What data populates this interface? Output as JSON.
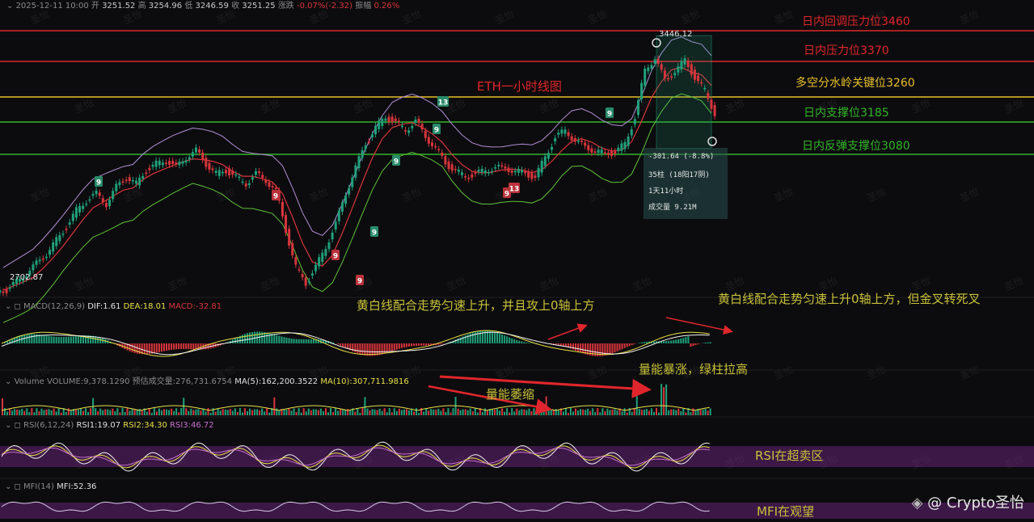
{
  "header": {
    "date": "2025-12-11 10:00",
    "open_label": "开",
    "open": "3251.52",
    "high_label": "高",
    "high": "3254.96",
    "low_label": "低",
    "low": "3246.59",
    "close_label": "收",
    "close": "3251.25",
    "change_label": "涨跌",
    "change": "-0.07%(-2.32)",
    "amplitude_label": "振幅",
    "amplitude": "0.26%"
  },
  "chart_title": "ETH一小时线图",
  "price_labels": {
    "max": "3446.12",
    "min": "2702.87"
  },
  "levels": [
    {
      "label": "日内回调压力位3460",
      "price": 3460,
      "color": "#e0262c"
    },
    {
      "label": "日内压力位3370",
      "price": 3370,
      "color": "#e0262c"
    },
    {
      "label": "多空分水岭关键位3260",
      "price": 3260,
      "color": "#e9c02a"
    },
    {
      "label": "日内支撑位3185",
      "price": 3185,
      "color": "#33b52a"
    },
    {
      "label": "日内反弹支撑位3080",
      "price": 3080,
      "color": "#33b52a"
    }
  ],
  "measure_box": {
    "change": "-301.64 (-8.8%)",
    "bars": "35柱 (18阳17阴)",
    "duration": "1天11小时",
    "volume": "成交量 9.21M"
  },
  "td_markers": [
    "9",
    "9",
    "9",
    "9",
    "9",
    "9",
    "13",
    "9",
    "9",
    "13",
    "9"
  ],
  "macd": {
    "name": "MACD(12,26,9)",
    "dif_label": "DIF:",
    "dif": "1.61",
    "dea_label": "DEA:",
    "dea": "18.01",
    "macd_label": "MACD:",
    "macd": "-32.81"
  },
  "volume": {
    "name": "Volume",
    "vol": "VOLUME:9,378.1290",
    "est": "预估成交量:276,731.6754",
    "ma5": "MA(5):162,200.3522",
    "ma10": "MA(10):307,711.9816"
  },
  "rsi": {
    "name": "RSI(6,12,24)",
    "rsi1": "RSI1:19.07",
    "rsi2": "RSI2:34.30",
    "rsi3": "RSI3:46.72"
  },
  "mfi": {
    "name": "MFI(14)",
    "mfi": "MFI:52.36"
  },
  "annotations": {
    "macd1": "黄白线配合走势匀速上升，并且攻上0轴上方",
    "macd2": "黄白线配合走势匀速上升0轴上方，但金叉转死叉",
    "vol_up": "量能暴涨，绿柱拉高",
    "vol_down": "量能萎缩",
    "rsi": "RSI在超卖区",
    "mfi": "MFI在观望"
  },
  "brand": "@ Crypto圣怡",
  "watermark": "圣怡",
  "colors": {
    "up": "#1fa07a",
    "down": "#d8353c",
    "boll_upper": "#b38fd6",
    "boll_mid": "#d8353c",
    "boll_lower": "#5fc23a",
    "dif": "#e9e04a",
    "dea": "#f2f2f2"
  },
  "chart_data": {
    "type": "candlestick",
    "title": "ETH一小时线图",
    "x": [
      "t0",
      "t1",
      "t2",
      "t3",
      "t4",
      "t5",
      "t6",
      "t7",
      "t8",
      "t9",
      "t10",
      "t11",
      "t12",
      "t13",
      "t14",
      "t15",
      "t16",
      "t17",
      "t18",
      "t19",
      "t20",
      "t21",
      "t22",
      "t23",
      "t24",
      "t25",
      "t26",
      "t27",
      "t28",
      "t29",
      "t30",
      "t31",
      "t32",
      "t33",
      "t34",
      "t35",
      "t36",
      "t37",
      "t38",
      "t39",
      "t40",
      "t41",
      "t42",
      "t43",
      "t44",
      "t45",
      "t46",
      "t47",
      "t48",
      "t49",
      "t50",
      "t51",
      "t52",
      "t53",
      "t54",
      "t55",
      "t56",
      "t57",
      "t58",
      "t59",
      "t60",
      "t61",
      "t62",
      "t63",
      "t64",
      "t65",
      "t66",
      "t67",
      "t68",
      "t69",
      "t70",
      "t71"
    ],
    "close": [
      2720,
      2745,
      2770,
      2800,
      2830,
      2870,
      2910,
      2960,
      2990,
      3010,
      2980,
      3030,
      3060,
      3040,
      3080,
      3100,
      3110,
      3090,
      3120,
      3140,
      3100,
      3070,
      3080,
      3060,
      3040,
      3070,
      3050,
      3020,
      2900,
      2790,
      2740,
      2790,
      2850,
      2920,
      3010,
      3090,
      3160,
      3210,
      3240,
      3225,
      3200,
      3230,
      3180,
      3150,
      3100,
      3080,
      3060,
      3070,
      3080,
      3090,
      3085,
      3080,
      3070,
      3060,
      3120,
      3180,
      3200,
      3170,
      3150,
      3140,
      3130,
      3135,
      3160,
      3240,
      3380,
      3420,
      3350,
      3380,
      3410,
      3360,
      3320,
      3251
    ],
    "ylim": [
      2650,
      3500
    ]
  }
}
